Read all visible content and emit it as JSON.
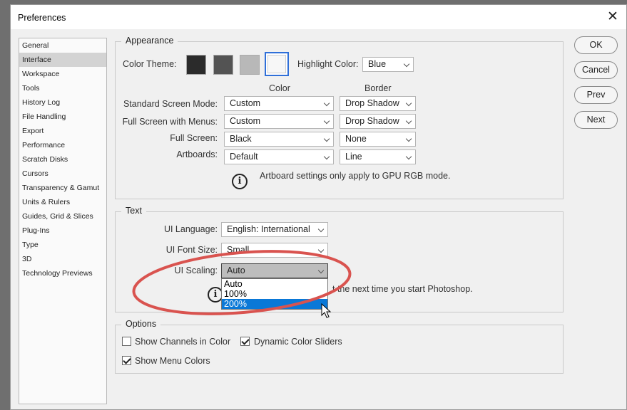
{
  "window": {
    "title": "Preferences",
    "close_glyph": "✕"
  },
  "sidebar": {
    "items": [
      {
        "label": "General"
      },
      {
        "label": "Interface",
        "active": true
      },
      {
        "label": "Workspace"
      },
      {
        "label": "Tools"
      },
      {
        "label": "History Log"
      },
      {
        "label": "File Handling"
      },
      {
        "label": "Export"
      },
      {
        "label": "Performance"
      },
      {
        "label": "Scratch Disks"
      },
      {
        "label": "Cursors"
      },
      {
        "label": "Transparency & Gamut"
      },
      {
        "label": "Units & Rulers"
      },
      {
        "label": "Guides, Grid & Slices"
      },
      {
        "label": "Plug-Ins"
      },
      {
        "label": "Type"
      },
      {
        "label": "3D"
      },
      {
        "label": "Technology Previews"
      }
    ]
  },
  "appearance": {
    "title": "Appearance",
    "color_theme_label": "Color Theme:",
    "theme_swatches": [
      "#2b2b2b",
      "#535353",
      "#b8b8b8",
      "#f3f3f3"
    ],
    "highlight_label": "Highlight Color:",
    "highlight_value": "Blue",
    "col_color": "Color",
    "col_border": "Border",
    "rows": [
      {
        "label": "Standard Screen Mode:",
        "color": "Custom",
        "border": "Drop Shadow"
      },
      {
        "label": "Full Screen with Menus:",
        "color": "Custom",
        "border": "Drop Shadow"
      },
      {
        "label": "Full Screen:",
        "color": "Black",
        "border": "None"
      },
      {
        "label": "Artboards:",
        "color": "Default",
        "border": "Line"
      }
    ],
    "note": "Artboard settings only apply to GPU RGB mode."
  },
  "text": {
    "title": "Text",
    "ui_language_label": "UI Language:",
    "ui_language_value": "English: International",
    "ui_font_size_label": "UI Font Size:",
    "ui_font_size_value": "Small",
    "ui_scaling_label": "UI Scaling:",
    "ui_scaling_value": "Auto",
    "scaling_options": [
      "Auto",
      "100%",
      "200%"
    ],
    "note_visible": "t the next time you start Photoshop."
  },
  "options": {
    "title": "Options",
    "show_channels": {
      "label": "Show Channels in Color",
      "checked": false
    },
    "dynamic_sliders": {
      "label": "Dynamic Color Sliders",
      "checked": true
    },
    "show_menu_colors": {
      "label": "Show Menu Colors",
      "checked": true
    }
  },
  "buttons": {
    "ok": "OK",
    "cancel": "Cancel",
    "prev": "Prev",
    "next": "Next"
  },
  "colors": {
    "highlight_blue": "#0a78d7",
    "annotation_red": "#d9534f",
    "selected_swatch_border": "#2f6fd8"
  }
}
